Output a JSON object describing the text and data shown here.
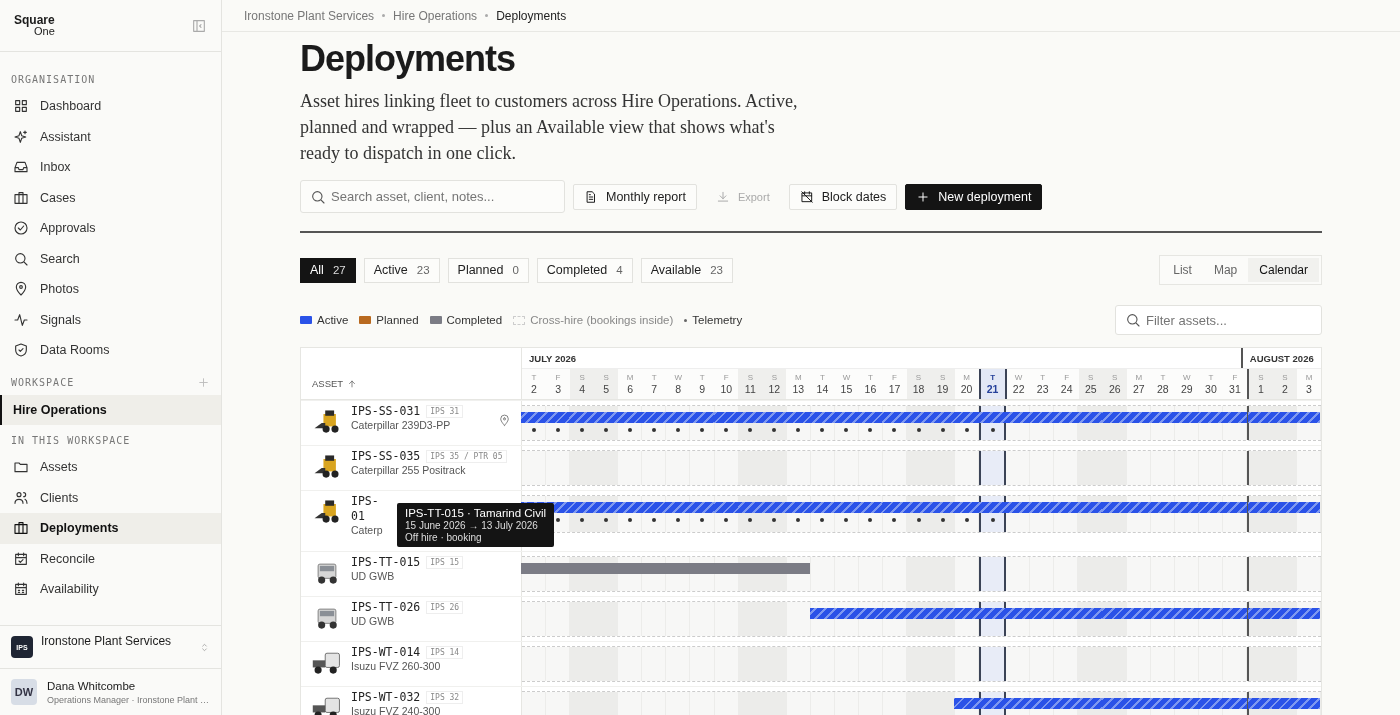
{
  "sidebar": {
    "logo": {
      "line_1": "Square",
      "line_2": "One"
    },
    "sections": [
      {
        "title": "ORGANISATION",
        "items": [
          {
            "label": "Dashboard",
            "selected": false
          },
          {
            "label": "Assistant",
            "selected": false
          },
          {
            "label": "Inbox",
            "selected": false
          },
          {
            "label": "Cases",
            "selected": false
          },
          {
            "label": "Approvals",
            "selected": false
          },
          {
            "label": "Search",
            "selected": false
          },
          {
            "label": "Photos",
            "selected": false
          },
          {
            "label": "Signals",
            "selected": false
          },
          {
            "label": "Data Rooms",
            "selected": false
          }
        ]
      },
      {
        "title": "WORKSPACE",
        "add_button": true,
        "items": [
          {
            "label": "Hire Operations",
            "selected": true
          }
        ]
      },
      {
        "title": "IN THIS WORKSPACE",
        "items": [
          {
            "label": "Assets",
            "selected": false
          },
          {
            "label": "Clients",
            "selected": false
          },
          {
            "label": "Deployments",
            "selected": true
          },
          {
            "label": "Reconcile",
            "selected": false
          },
          {
            "label": "Availability",
            "selected": false
          }
        ]
      }
    ],
    "organisation": {
      "badge": "IPS",
      "name": "Ironstone Plant Services"
    },
    "user": {
      "initials": "DW",
      "name": "Dana Whitcombe",
      "role": "Operations Manager · Ironstone Plant …"
    }
  },
  "breadcrumb": [
    "Ironstone Plant Services",
    "Hire Operations",
    "Deployments"
  ],
  "title": "Deployments",
  "description": "Asset hires linking fleet to customers across Hire Operations. Active, planned and wrapped — plus an Available view that shows what's ready to dispatch in one click.",
  "toolbar": {
    "search_placeholder": "Search asset, client, notes...",
    "buttons": [
      {
        "label": "Monthly report",
        "kind": "secondary",
        "disabled": false
      },
      {
        "label": "Export",
        "kind": "ghost",
        "disabled": true
      },
      {
        "label": "Block dates",
        "kind": "secondary",
        "disabled": false
      },
      {
        "label": "New deployment",
        "kind": "primary",
        "disabled": false
      }
    ]
  },
  "filters": [
    {
      "label": "All",
      "count": "27",
      "selected": true
    },
    {
      "label": "Active",
      "count": "23",
      "selected": false
    },
    {
      "label": "Planned",
      "count": "0",
      "selected": false
    },
    {
      "label": "Completed",
      "count": "4",
      "selected": false
    },
    {
      "label": "Available",
      "count": "23",
      "selected": false
    }
  ],
  "views": [
    {
      "label": "List",
      "selected": false
    },
    {
      "label": "Map",
      "selected": false
    },
    {
      "label": "Calendar",
      "selected": true
    }
  ],
  "legend": [
    {
      "label": "Active",
      "kind": "swatch",
      "color": "#2a52e8"
    },
    {
      "label": "Planned",
      "kind": "swatch",
      "color": "#b8691f"
    },
    {
      "label": "Completed",
      "kind": "swatch",
      "color": "#7b7c85"
    },
    {
      "label": "Cross-hire (bookings inside)",
      "kind": "dashed"
    },
    {
      "label": "Telemetry",
      "kind": "dot"
    }
  ],
  "filter_placeholder": "Filter assets...",
  "calendar": {
    "asset_heading": "ASSET",
    "months": [
      {
        "label": "JULY 2026",
        "days": [
          {
            "weekday": "T",
            "day": "2",
            "weekend": false,
            "today": false
          },
          {
            "weekday": "F",
            "day": "3",
            "weekend": false,
            "today": false
          },
          {
            "weekday": "S",
            "day": "4",
            "weekend": true,
            "today": false
          },
          {
            "weekday": "S",
            "day": "5",
            "weekend": true,
            "today": false
          },
          {
            "weekday": "M",
            "day": "6",
            "weekend": false,
            "today": false
          },
          {
            "weekday": "T",
            "day": "7",
            "weekend": false,
            "today": false
          },
          {
            "weekday": "W",
            "day": "8",
            "weekend": false,
            "today": false
          },
          {
            "weekday": "T",
            "day": "9",
            "weekend": false,
            "today": false
          },
          {
            "weekday": "F",
            "day": "10",
            "weekend": false,
            "today": false
          },
          {
            "weekday": "S",
            "day": "11",
            "weekend": true,
            "today": false
          },
          {
            "weekday": "S",
            "day": "12",
            "weekend": true,
            "today": false
          },
          {
            "weekday": "M",
            "day": "13",
            "weekend": false,
            "today": false
          },
          {
            "weekday": "T",
            "day": "14",
            "weekend": false,
            "today": false
          },
          {
            "weekday": "W",
            "day": "15",
            "weekend": false,
            "today": false
          },
          {
            "weekday": "T",
            "day": "16",
            "weekend": false,
            "today": false
          },
          {
            "weekday": "F",
            "day": "17",
            "weekend": false,
            "today": false
          },
          {
            "weekday": "S",
            "day": "18",
            "weekend": true,
            "today": false
          },
          {
            "weekday": "S",
            "day": "19",
            "weekend": true,
            "today": false
          },
          {
            "weekday": "M",
            "day": "20",
            "weekend": false,
            "today": false
          },
          {
            "weekday": "T",
            "day": "21",
            "weekend": false,
            "today": true
          },
          {
            "weekday": "W",
            "day": "22",
            "weekend": false,
            "today": false
          },
          {
            "weekday": "T",
            "day": "23",
            "weekend": false,
            "today": false
          },
          {
            "weekday": "F",
            "day": "24",
            "weekend": false,
            "today": false
          },
          {
            "weekday": "S",
            "day": "25",
            "weekend": true,
            "today": false
          },
          {
            "weekday": "S",
            "day": "26",
            "weekend": true,
            "today": false
          },
          {
            "weekday": "M",
            "day": "27",
            "weekend": false,
            "today": false
          },
          {
            "weekday": "T",
            "day": "28",
            "weekend": false,
            "today": false
          },
          {
            "weekday": "W",
            "day": "29",
            "weekend": false,
            "today": false
          },
          {
            "weekday": "T",
            "day": "30",
            "weekend": false,
            "today": false
          },
          {
            "weekday": "F",
            "day": "31",
            "weekend": false,
            "today": false
          }
        ]
      },
      {
        "label": "AUGUST 2026",
        "days": [
          {
            "weekday": "S",
            "day": "1",
            "weekend": true,
            "today": false
          },
          {
            "weekday": "S",
            "day": "2",
            "weekend": true,
            "today": false
          },
          {
            "weekday": "M",
            "day": "3",
            "weekend": false,
            "today": false
          }
        ]
      }
    ],
    "rows": [
      {
        "kind": "skid_steer",
        "code": "IPS-SS-031",
        "tag": "IPS 31",
        "model": "Caterpillar 239D3-PP",
        "location_pin": true,
        "bar": {
          "kind": "active",
          "days": [
            true,
            true,
            true,
            true,
            true,
            true,
            true,
            true,
            true,
            true,
            true,
            true,
            true,
            true,
            true,
            true,
            true,
            true,
            true,
            true,
            true,
            true,
            true,
            true,
            true,
            true,
            true,
            true,
            true,
            true,
            true,
            true,
            true
          ]
        },
        "telemetry": [
          true,
          true,
          true,
          true,
          true,
          true,
          true,
          true,
          true,
          true,
          true,
          true,
          true,
          true,
          true,
          true,
          true,
          true,
          true,
          true,
          false,
          false,
          false,
          false,
          false,
          false,
          false,
          false,
          false,
          false,
          false,
          false,
          false
        ]
      },
      {
        "kind": "skid_steer",
        "code": "IPS-SS-035",
        "tag": "IPS 35 / PTR 05",
        "model": "Caterpillar 255 Positrack"
      },
      {
        "kind": "skid_steer",
        "code": "IPS-",
        "code_continued": "01",
        "model": "Caterp",
        "bar": {
          "kind": "active",
          "days": [
            true,
            true,
            true,
            true,
            true,
            true,
            true,
            true,
            true,
            true,
            true,
            true,
            true,
            true,
            true,
            true,
            true,
            true,
            true,
            true,
            true,
            true,
            true,
            true,
            true,
            true,
            true,
            true,
            true,
            true,
            true,
            true,
            true
          ]
        },
        "telemetry": [
          false,
          true,
          true,
          true,
          true,
          true,
          true,
          true,
          true,
          true,
          true,
          true,
          true,
          true,
          true,
          true,
          true,
          true,
          true,
          true,
          false,
          false,
          false,
          false,
          false,
          false,
          false,
          false,
          false,
          false,
          false,
          false,
          false
        ]
      },
      {
        "kind": "truck",
        "code": "IPS-TT-015",
        "tag": "IPS 15",
        "model": "UD GWB",
        "bar": {
          "kind": "completed",
          "days": [
            true,
            true,
            true,
            true,
            true,
            true,
            true,
            true,
            true,
            true,
            true,
            true,
            false,
            false,
            false,
            false,
            false,
            false,
            false,
            false,
            false,
            false,
            false,
            false,
            false,
            false,
            false,
            false,
            false,
            false,
            false,
            false,
            false
          ]
        }
      },
      {
        "kind": "truck",
        "code": "IPS-TT-026",
        "tag": "IPS 26",
        "model": "UD GWB",
        "bar": {
          "kind": "active",
          "days": [
            false,
            false,
            false,
            false,
            false,
            false,
            false,
            false,
            false,
            false,
            false,
            false,
            true,
            true,
            true,
            true,
            true,
            true,
            true,
            true,
            true,
            true,
            true,
            true,
            true,
            true,
            true,
            true,
            true,
            true,
            true,
            true,
            true
          ]
        }
      },
      {
        "kind": "tipper",
        "code": "IPS-WT-014",
        "tag": "IPS 14",
        "model": "Isuzu FVZ 260-300"
      },
      {
        "kind": "tipper",
        "code": "IPS-WT-032",
        "tag": "IPS 32",
        "model": "Isuzu FVZ 240-300",
        "bar": {
          "kind": "active",
          "days": [
            false,
            false,
            false,
            false,
            false,
            false,
            false,
            false,
            false,
            false,
            false,
            false,
            false,
            false,
            false,
            false,
            false,
            false,
            true,
            true,
            true,
            true,
            true,
            true,
            true,
            true,
            true,
            true,
            true,
            true,
            true,
            true,
            true
          ]
        }
      }
    ],
    "tooltip": {
      "title": "IPS-TT-015 · Tamarind Civil",
      "dates": "15 June 2026 → 13 July 2026",
      "detail": "Off hire · booking"
    }
  }
}
